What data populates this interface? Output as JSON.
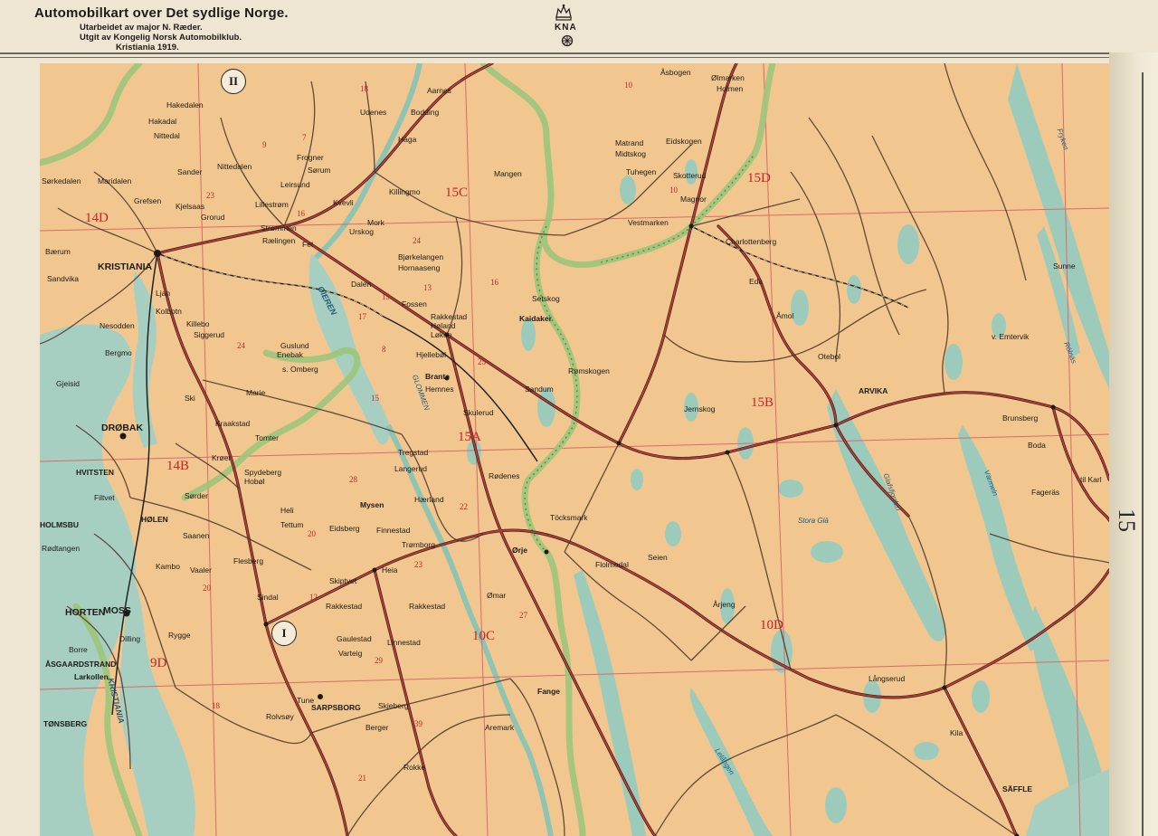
{
  "header": {
    "title": "Automobilkart over Det sydlige Norge.",
    "line1": "Utarbeidet av major N. Ræder.",
    "line2": "Utgit av Kongelig Norsk Automobilklub.",
    "line3": "Kristiania 1919.",
    "emblem_text": "KNA"
  },
  "sheet_number": "15",
  "colors": {
    "land": "#f3c991",
    "water": "#9fcbbf",
    "border_green": "#9fc67a",
    "road_red": "#b3262b",
    "road_dark": "#3a2a24",
    "grid_red": "#d65a5a",
    "paper": "#eee6d2"
  },
  "map": {
    "sheet_labels": [
      "14D",
      "15C",
      "15D",
      "15B",
      "14B",
      "15A",
      "10C",
      "10D",
      "9D"
    ],
    "roman_markers": [
      "II",
      "I"
    ],
    "place_labels": {
      "kristiania": "KRISTIANIA",
      "drobak": "DRØBAK",
      "moss": "MOSS",
      "horten": "HORTEN",
      "arvika": "ARVIKA",
      "jernskog": "Jernskog",
      "charlottenberg": "Charlottenberg",
      "eda": "Eda",
      "amol": "Åmol",
      "otebol": "Otebol",
      "eidskogen": "Eidskogen",
      "skotterud": "Skotterud",
      "magnor": "Magnor",
      "vestmarken": "Vestmarken",
      "asbogen": "Åsbogen",
      "olmarken": "Ølmarken",
      "holmen": "Holmen",
      "matrand": "Matrand",
      "midtskog": "Midtskog",
      "tuhegen": "Tuhegen",
      "mangen": "Mangen",
      "udenes": "Udenes",
      "bodding": "Bodding",
      "aarnes": "Aarnes",
      "haga": "Haga",
      "frogner": "Frogner",
      "lillestrom": "Lillestrøm",
      "strommen": "Strømmen",
      "lorenskog": "Rælingen",
      "fet": "Fet",
      "sorum": "Sørum",
      "urskog": "Urskog",
      "bjorkelangen": "Bjørkelangen",
      "hornaaseng": "Hornaaseng",
      "fossen": "Fossen",
      "rakkestad_a": "Rakkestad",
      "heland": "Høland",
      "loken": "Løken",
      "hjellebol": "Hjellebøl",
      "setskog": "Setskog",
      "kaidaker": "Kaidaker",
      "romskogen": "Rømskogen",
      "sandum": "Sandum",
      "skulerud": "Skulerud",
      "hemnes": "Hemnes",
      "brante": "Brante",
      "tregstad": "Tregstad",
      "langerud": "Langerud",
      "rodenes": "Rødenes",
      "haerland": "Hærland",
      "mysen": "Mysen",
      "eidsberg": "Eidsberg",
      "tromborg": "Trømborg",
      "finnestad": "Finnestad",
      "orje": "Ørje",
      "tocksmark": "Töcksmark",
      "flolmedal": "Flolmedal",
      "seien": "Seien",
      "arjeng": "Årjeng",
      "langserud": "Långserud",
      "sunne": "Sunne",
      "emterik": "v. Emtervik",
      "brunsberg": "Brunsberg",
      "boda": "Boda",
      "fageras": "Fageräs",
      "til_karlstad": "til Karl",
      "saffle": "SÄFFLE",
      "kila": "Kila",
      "hakedalen": "Hakedalen",
      "nittedal": "Nittedal",
      "nittedalen": "Nittedalen",
      "sorkedalen": "Sørkedalen",
      "maridalen": "Maridalen",
      "grefsen": "Grefsen",
      "grorud": "Grorud",
      "baerum": "Bærum",
      "sandvika": "Sandvika",
      "nesodden": "Nesodden",
      "bergmo": "Bergmo",
      "enebak": "Enebak",
      "ski": "Ski",
      "kraakstad": "Kraakstad",
      "tomter": "Tomter",
      "spydeberg": "Spydeberg",
      "hobol": "Hobøl",
      "sorder": "Sørder",
      "saanen": "Saanen",
      "vaaler": "Vaaler",
      "kambo": "Kambo",
      "rygge": "Rygge",
      "dilling": "Dilling",
      "larkollen": "Larkollen",
      "rasgaardstrand": "ÅSGAARDSTRAND",
      "borre": "Borre",
      "tonsberg": "TØNSBERG",
      "holmsbu": "HOLMSBU",
      "hvitsten": "HVITSTEN",
      "filtvet": "Filtvet",
      "holen": "HØLEN",
      "rodtangen": "Rødtangen",
      "gjeisid": "Gjeisid",
      "flesberg": "Flesberg",
      "tettum": "Tettum",
      "heli": "Heli",
      "skiptvet": "Skiptvet",
      "rakkestad": "Rakkestad",
      "varteig": "Varteig",
      "gaulestad": "Gaulestad",
      "sarpsborg": "SARPSBORG",
      "skjeberg": "Skjeberg",
      "rokke": "Rokke",
      "aremark": "Aremark",
      "fange": "Fange",
      "omar": "Ømar",
      "kroer": "Krøer",
      "maria": "Marie",
      "dalen": "Dalen",
      "mork": "Mork",
      "kvevli": "Kvevli",
      "leirsund": "Leirsund",
      "killingmo": "Killingmo",
      "hakadal": "Hakadal",
      "sander": "Sander",
      "kjelsaas": "Kjelsaas",
      "ljan": "Ljan",
      "killebo": "Killebo",
      "siggerud": "Siggerud",
      "kolbotn": "Kolbotn",
      "guslund": "Guslund",
      "ombergs": "s. Omberg",
      "heia": "Heia",
      "sindal": "Sindal",
      "linnestad": "Linnestad",
      "berger": "Berger",
      "rolvsøy": "Rolvsøy",
      "tune": "Tune"
    },
    "water_labels": {
      "oieren": "ØIEREN",
      "glommen": "GLOMMEN",
      "kristiania_fjord": "KRISTIANIA",
      "glafsfjorden": "Glafsfjorden",
      "varmeln": "Värmeln",
      "stora_gla": "Stora Glä",
      "lelangen": "Lelången",
      "fryken": "Fryken",
      "rolnas": "Rölnäs"
    },
    "road_numbers": [
      "23",
      "16",
      "24",
      "13",
      "16",
      "17",
      "19",
      "8",
      "25",
      "15",
      "22",
      "20",
      "12",
      "28",
      "23",
      "27",
      "29",
      "39",
      "18",
      "9",
      "10",
      "7",
      "24",
      "18",
      "20",
      "21",
      "10"
    ]
  }
}
